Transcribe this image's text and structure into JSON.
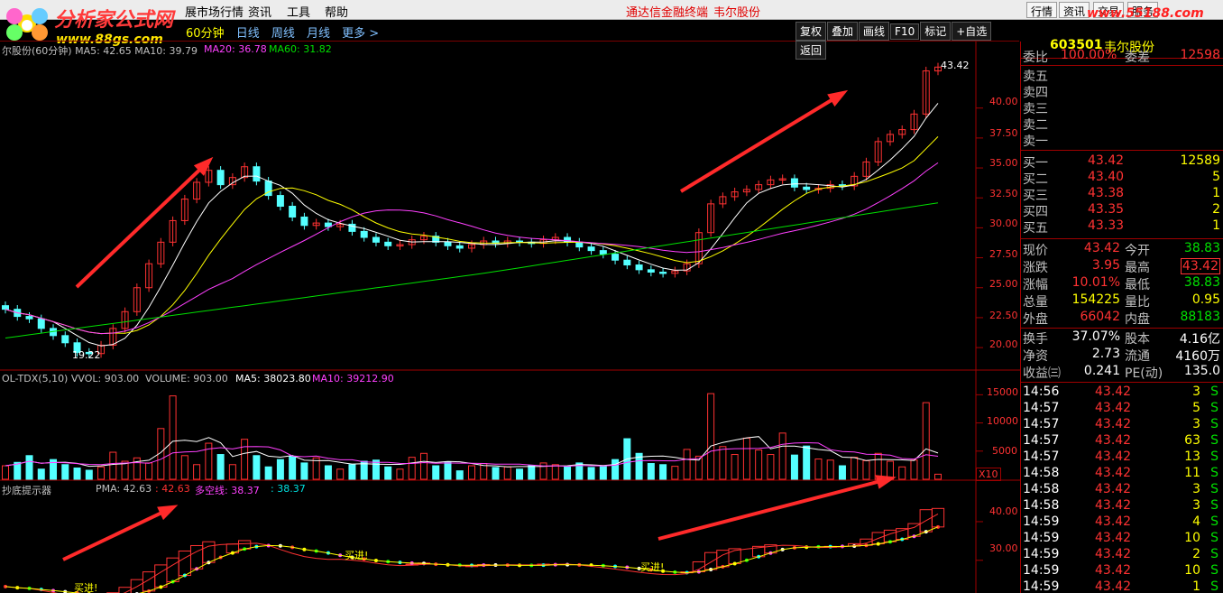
{
  "menu": {
    "items": [
      "展市场行情",
      "资讯",
      "工具",
      "帮助"
    ],
    "promo1": "通达信金融终端",
    "promo2": "韦尔股份",
    "right_buttons": [
      "行情",
      "资讯",
      "交易",
      "服务"
    ]
  },
  "logo": {
    "title": "分析家公式网",
    "url": "www.88gs.com"
  },
  "site_watermark": "www.55188.com",
  "toolbar": {
    "periods": [
      "60分钟",
      "日线",
      "周线",
      "月线",
      "更多 >"
    ],
    "buttons": [
      "复权",
      "叠加",
      "画线",
      "F10",
      "标记",
      "+自选",
      "返回"
    ]
  },
  "main_chart": {
    "title_partial": "尔股份(60分钟)  MA5: 42.65  MA10: 39.79",
    "ma20": "MA20: 36.78",
    "ma60": "MA60: 31.82",
    "y_ticks": [
      "40.00",
      "37.50",
      "35.00",
      "32.50",
      "30.00",
      "27.50",
      "25.00",
      "22.50",
      "20.00"
    ],
    "high_label": "43.42",
    "low_label": "19.22"
  },
  "volume_chart": {
    "title": "OL-TDX(5,10) VVOL: 903.00",
    "volume": "VOLUME: 903.00",
    "ma5": "MA5: 38023.80",
    "ma10": "MA10: 39212.90",
    "y_ticks": [
      "15000",
      "10000",
      "5000"
    ],
    "unit": "X10"
  },
  "indicator_chart": {
    "title": "抄底提示器",
    "pma": "PMA: 42.63",
    "pma2": ": 42.63",
    "dk_label": "多空线: 38.37",
    "dk2": ": 38.37",
    "y_ticks": [
      "40.00",
      "30.00"
    ],
    "signals": [
      "买进!",
      "买进!",
      "买进!"
    ]
  },
  "chart_data": {
    "type": "candlestick",
    "title": "尔股份(60分钟)",
    "close_series": [
      23.2,
      22.6,
      22.4,
      21.6,
      21.0,
      20.4,
      19.6,
      19.5,
      20.2,
      21.6,
      23.0,
      25.0,
      27.0,
      28.8,
      30.6,
      32.4,
      33.8,
      34.8,
      33.6,
      34.2,
      35.1,
      33.9,
      32.7,
      31.8,
      30.9,
      30.2,
      30.4,
      30.1,
      30.3,
      29.7,
      29.2,
      28.8,
      28.5,
      28.6,
      29.0,
      29.3,
      28.8,
      28.5,
      28.3,
      28.6,
      28.9,
      28.7,
      28.9,
      28.8,
      28.7,
      29.0,
      29.2,
      28.8,
      28.4,
      28.1,
      27.8,
      27.3,
      26.9,
      26.5,
      26.3,
      26.2,
      26.4,
      27.0,
      29.6,
      32.0,
      32.6,
      33.0,
      33.2,
      33.6,
      34.0,
      34.1,
      33.4,
      33.2,
      33.3,
      33.6,
      33.5,
      34.3,
      35.5,
      37.2,
      37.8,
      38.2,
      39.5,
      43.1,
      43.42
    ],
    "high": 43.42,
    "low": 19.22,
    "ma_values": {
      "MA5": 42.65,
      "MA10": 39.79,
      "MA20": 36.78,
      "MA60": 31.82
    },
    "ylim": [
      18.5,
      44.5
    ],
    "volume_ylim": [
      0,
      16500
    ],
    "indicator_ylim": [
      22,
      47
    ],
    "colors": {
      "up": "#ff3232",
      "down": "#54ffff",
      "ma5": "#ffffff",
      "ma10": "#ffff00",
      "ma20": "#ff40ff",
      "ma60": "#00e000"
    }
  },
  "quote": {
    "code": "603501",
    "name": "韦尔股份",
    "weibi_label": "委比",
    "weibi": "100.00%",
    "weicha_label": "委差",
    "weicha": "12598",
    "sell": [
      {
        "label": "卖五"
      },
      {
        "label": "卖四"
      },
      {
        "label": "卖三"
      },
      {
        "label": "卖二"
      },
      {
        "label": "卖一"
      }
    ],
    "buy": [
      {
        "label": "买一",
        "price": "43.42",
        "vol": "12589"
      },
      {
        "label": "买二",
        "price": "43.40",
        "vol": "5"
      },
      {
        "label": "买三",
        "price": "43.38",
        "vol": "1"
      },
      {
        "label": "买四",
        "price": "43.35",
        "vol": "2"
      },
      {
        "label": "买五",
        "price": "43.33",
        "vol": "1"
      }
    ],
    "stats": [
      {
        "l1": "现价",
        "v1": "43.42",
        "l2": "今开",
        "v2": "38.83"
      },
      {
        "l1": "涨跌",
        "v1": "3.95",
        "l2": "最高",
        "v2": "43.42"
      },
      {
        "l1": "涨幅",
        "v1": "10.01%",
        "l2": "最低",
        "v2": "38.83"
      },
      {
        "l1": "总量",
        "v1": "154225",
        "l2": "量比",
        "v2": "0.95"
      },
      {
        "l1": "外盘",
        "v1": "66042",
        "l2": "内盘",
        "v2": "88183"
      }
    ],
    "stats2": [
      {
        "l1": "换手",
        "v1": "37.07%",
        "l2": "股本",
        "v2": "4.16亿"
      },
      {
        "l1": "净资",
        "v1": "2.73",
        "l2": "流通",
        "v2": "4160万"
      },
      {
        "l1": "收益㈢",
        "v1": "0.241",
        "l2": "PE(动)",
        "v2": "135.0"
      }
    ],
    "ticks": [
      {
        "t": "14:56",
        "p": "43.42",
        "v": "3",
        "s": "S"
      },
      {
        "t": "14:57",
        "p": "43.42",
        "v": "5",
        "s": "S"
      },
      {
        "t": "14:57",
        "p": "43.42",
        "v": "3",
        "s": "S"
      },
      {
        "t": "14:57",
        "p": "43.42",
        "v": "63",
        "s": "S"
      },
      {
        "t": "14:57",
        "p": "43.42",
        "v": "13",
        "s": "S"
      },
      {
        "t": "14:58",
        "p": "43.42",
        "v": "11",
        "s": "S"
      },
      {
        "t": "14:58",
        "p": "43.42",
        "v": "3",
        "s": "S"
      },
      {
        "t": "14:58",
        "p": "43.42",
        "v": "3",
        "s": "S"
      },
      {
        "t": "14:59",
        "p": "43.42",
        "v": "4",
        "s": "S"
      },
      {
        "t": "14:59",
        "p": "43.42",
        "v": "10",
        "s": "S"
      },
      {
        "t": "14:59",
        "p": "43.42",
        "v": "2",
        "s": "S"
      },
      {
        "t": "14:59",
        "p": "43.42",
        "v": "10",
        "s": "S"
      },
      {
        "t": "14:59",
        "p": "43.42",
        "v": "1",
        "s": "S"
      }
    ]
  }
}
